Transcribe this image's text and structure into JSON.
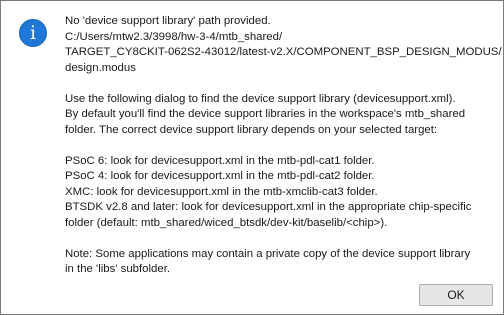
{
  "dialog": {
    "icon": "info-icon",
    "icon_glyph": "i",
    "accent_color": "#1f77d6",
    "message": {
      "p1": [
        "No 'device support library' path provided.",
        "C:/Users/mtw2.3/3998/hw-3-4/mtb_shared/",
        "TARGET_CY8CKIT-062S2-43012/latest-v2.X/COMPONENT_BSP_DESIGN_MODUS/",
        "design.modus"
      ],
      "p2": [
        "Use the following dialog to find the device support library (devicesupport.xml).",
        "By default you'll find the device support libraries in the workspace's mtb_shared",
        "folder. The correct device support library depends on your selected target:"
      ],
      "p3": [
        "PSoC 6: look for devicesupport.xml in the mtb-pdl-cat1 folder.",
        "PSoC 4: look for devicesupport.xml in the mtb-pdl-cat2 folder.",
        "XMC: look for devicesupport.xml in the mtb-xmclib-cat3 folder.",
        "BTSDK v2.8 and later: look for devicesupport.xml in the appropriate chip-specific",
        "folder (default: mtb_shared/wiced_btsdk/dev-kit/baselib/<chip>)."
      ],
      "p4": [
        "Note: Some applications may contain a private copy of the device support library",
        "in the 'libs' subfolder."
      ]
    },
    "ok_label": "OK"
  }
}
